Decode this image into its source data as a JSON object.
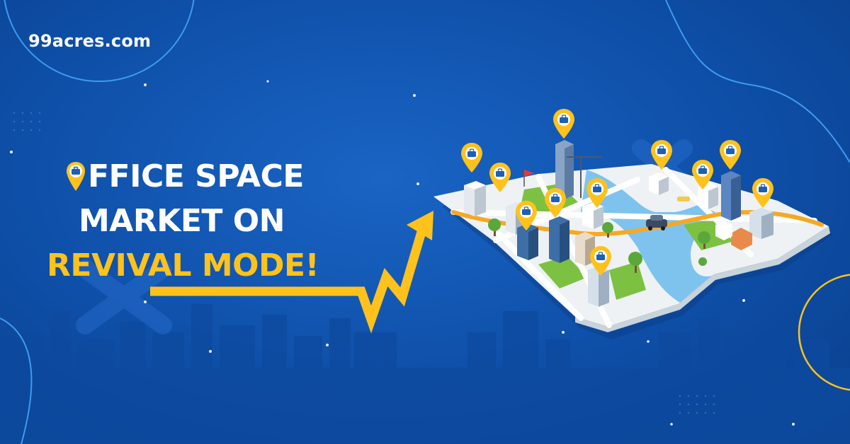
{
  "brand": {
    "logo_text": "99acres.com"
  },
  "headline": {
    "line1_rest": "FFICE SPACE",
    "line2": "MARKET ON",
    "line3": "REVIVAL MODE!"
  },
  "colors": {
    "background": "#0e4fa8",
    "accent_yellow": "#ffc21c",
    "text_white": "#ffffff",
    "road_orange": "#f7a823",
    "water_blue": "#7ec3ee",
    "park_green": "#7cc142"
  },
  "icons": [
    "map-pin-icon",
    "briefcase-icon",
    "trend-arrow-icon",
    "flag-icon",
    "car-icon"
  ]
}
